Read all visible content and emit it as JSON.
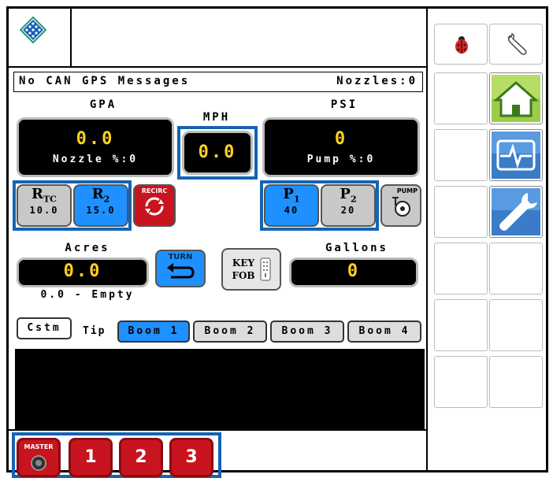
{
  "status_bar": {
    "message": "No CAN GPS Messages",
    "nozzles": "Nozzles:0"
  },
  "gpa": {
    "label": "GPA",
    "value": "0.0",
    "sub": "Nozzle %:0"
  },
  "mph": {
    "label": "MPH",
    "value": "0.0"
  },
  "psi": {
    "label": "PSI",
    "value": "0",
    "sub": "Pump %:0"
  },
  "rate_buttons": {
    "rtc": {
      "main": "R",
      "sub": "TC",
      "value": "10.0"
    },
    "r2": {
      "main": "R",
      "sub": "2",
      "value": "15.0"
    },
    "recirc": {
      "label": "RECIRC"
    }
  },
  "pressure_buttons": {
    "p1": {
      "main": "P",
      "sub": "1",
      "value": "40"
    },
    "p2": {
      "main": "P",
      "sub": "2",
      "value": "20"
    },
    "pump": {
      "label": "PUMP"
    }
  },
  "acres": {
    "label": "Acres",
    "value": "0.0",
    "sub": "0.0 - Empty"
  },
  "turn": {
    "label": "TURN"
  },
  "key_fob": {
    "line1": "KEY",
    "line2": "FOB"
  },
  "gallons": {
    "label": "Gallons",
    "value": "0"
  },
  "boom_row": {
    "cstm": "Cstm",
    "tip": "Tip",
    "booms": [
      "Boom 1",
      "Boom 2",
      "Boom 3",
      "Boom 4"
    ]
  },
  "sections": {
    "master": "MASTER",
    "buttons": [
      "1",
      "2",
      "3"
    ]
  },
  "colors": {
    "accent_blue": "#1e90ff",
    "frame_blue": "#1464b4",
    "red": "#c8141e",
    "yellow_value": "#ffd21f"
  },
  "icons": [
    "diamond-logo-icon",
    "ladybug-icon",
    "wrench-icon",
    "home-icon",
    "diagnostics-icon",
    "settings-wrench-icon"
  ]
}
